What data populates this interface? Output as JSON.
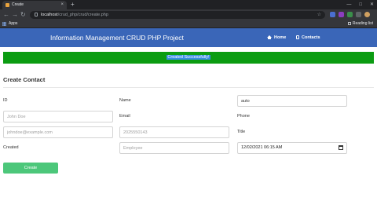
{
  "browser": {
    "tab_title": "Create",
    "tab_close": "×",
    "new_tab": "+",
    "url_host": "localhost",
    "url_path": "/crud_php/crud/create.php",
    "bookmarks_apps": "Apps",
    "reading_list": "Reading list",
    "window_controls": [
      "—",
      "□",
      "✕"
    ]
  },
  "app": {
    "title": "Information Management CRUD PHP Project",
    "nav": {
      "home": "Home",
      "contacts": "Contacts"
    }
  },
  "alert": {
    "message": "Created Successfully!"
  },
  "form": {
    "heading": "Create Contact",
    "labels": {
      "id": "ID",
      "name": "Name",
      "email": "Email",
      "phone": "Phone",
      "created": "Created",
      "title": "Title"
    },
    "id_value": "auto",
    "name_placeholder": "John Doe",
    "email_placeholder": "johndoe@example.com",
    "phone_placeholder": "2025550143",
    "title_placeholder": "Employee",
    "created_value": "12/02/2021 06:15 AM",
    "submit_label": "Create"
  },
  "colors": {
    "header": "#3a66b8",
    "alert": "#0b9c12",
    "button": "#4cc77a"
  }
}
